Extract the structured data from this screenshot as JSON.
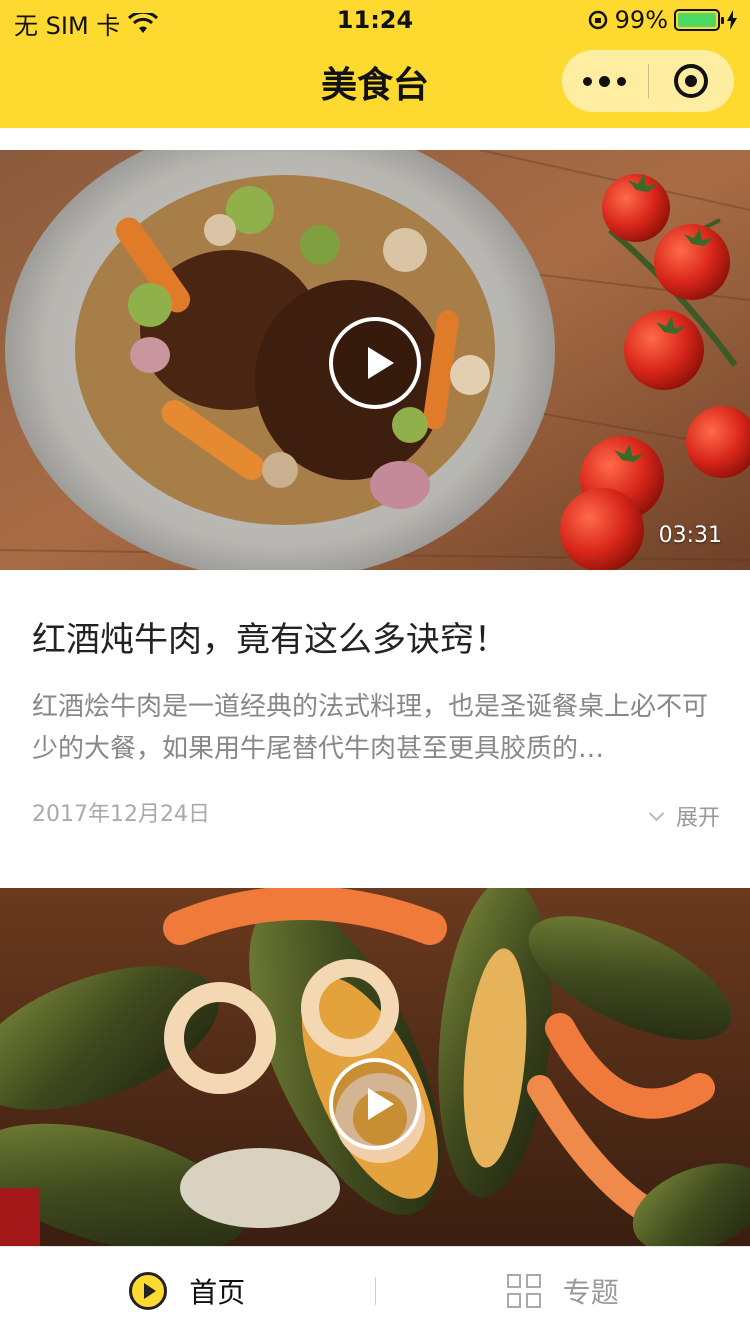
{
  "status_bar": {
    "carrier": "无 SIM 卡",
    "time": "11:24",
    "battery": "99%",
    "battery_level": 0.99
  },
  "nav": {
    "title": "美食台"
  },
  "feed": [
    {
      "title": "红酒炖牛肉，竟有这么多诀窍！",
      "description": "红酒烩牛肉是一道经典的法式料理，也是圣诞餐桌上必不可少的大餐，如果用牛尾替代牛肉甚至更具胶质的…",
      "date": "2017年12月24日",
      "duration": "03:31",
      "expand_label": "展开"
    }
  ],
  "tabbar": {
    "home_label": "首页",
    "topics_label": "专题"
  },
  "colors": {
    "accent": "#fed930",
    "text_primary": "#222222",
    "text_secondary": "#888888"
  }
}
